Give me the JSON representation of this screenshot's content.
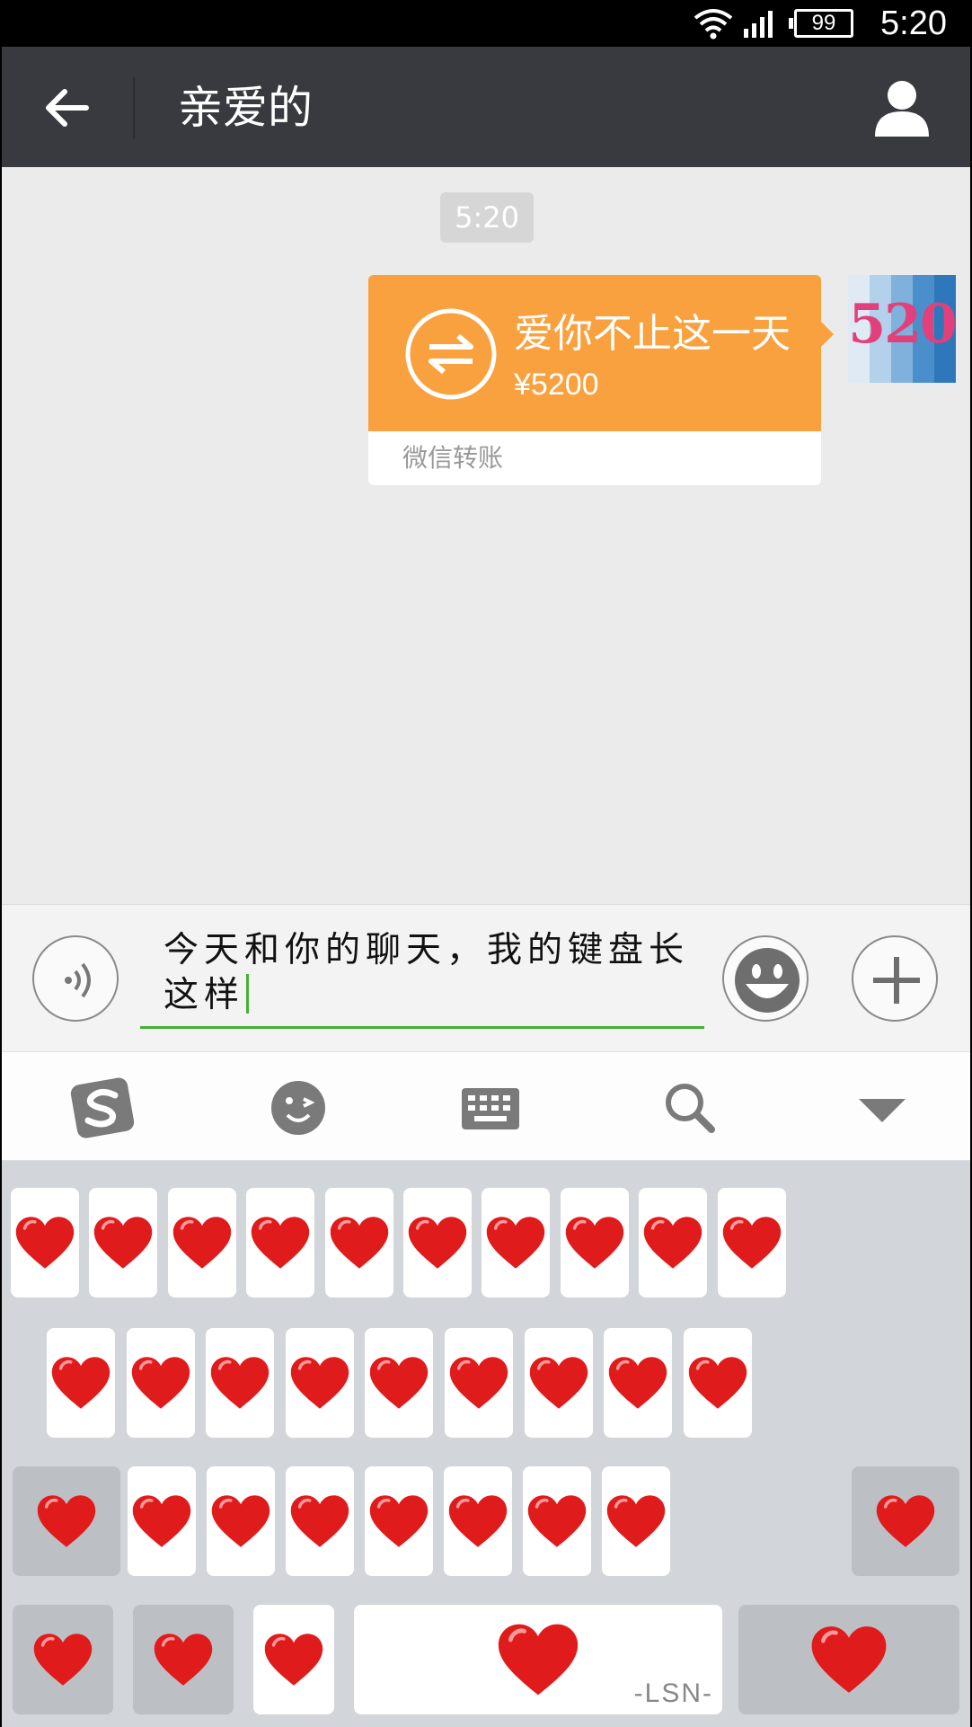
{
  "status_bar": {
    "time": "5:20",
    "battery": "99"
  },
  "header": {
    "title": "亲爱的"
  },
  "chat": {
    "timestamp": "5:20",
    "transfer": {
      "note": "爱你不止这一天",
      "amount": "¥5200",
      "footer": "微信转账"
    },
    "avatar_text": "520"
  },
  "input": {
    "text": "今天和你的聊天，我的键盘长这样"
  },
  "ime_toolbar": {
    "tools": [
      "sogou-logo-icon",
      "emoticon-icon",
      "keyboard-icon",
      "search-icon",
      "collapse-icon"
    ]
  },
  "keyboard": {
    "key_symbol": "heart",
    "row_counts": [
      10,
      9,
      9,
      5
    ],
    "space_label": "-LSN-",
    "heart_color": "#e01b1b"
  },
  "colors": {
    "header_bg": "#393a3f",
    "transfer_orange": "#f9a13e",
    "input_underline": "#45b036"
  }
}
